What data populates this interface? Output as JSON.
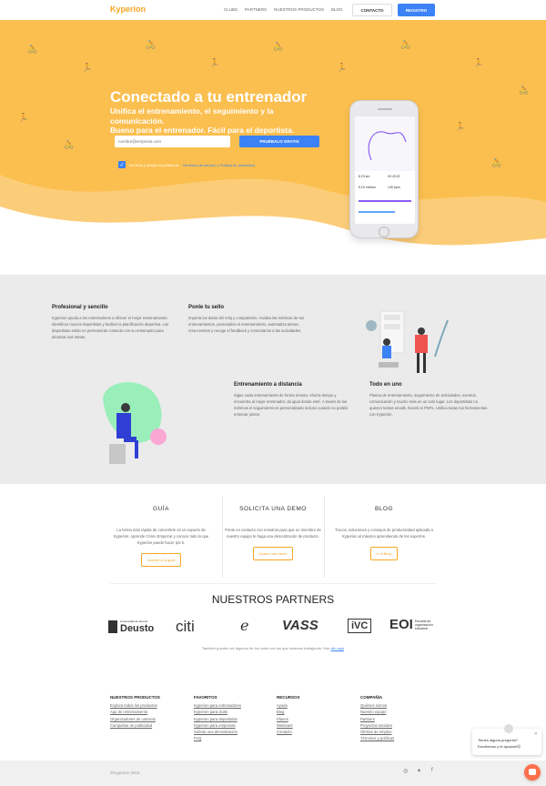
{
  "nav": {
    "logo": "Kyperion",
    "links": [
      "CLUBS",
      "PARTNERS",
      "NUESTROS PRODUCTOS",
      "BLOG"
    ],
    "contact": "CONTACTO",
    "register": "REGISTRO"
  },
  "hero": {
    "title": "Conectado a tu entrenador",
    "subtitle_1": "Unifica el entrenamiento, el seguimiento y la comunicación.",
    "subtitle_2": "Bueno para el entrenador. Fácil para el deportista.",
    "email_placeholder": "nombre@empresa.com",
    "try_button": "PRUÉBALO GRATIS",
    "terms_prefix": "He leído y acepto la política de",
    "terms_link": "Términos de servicio y Política de privacidad",
    "accent": "#3b82f6",
    "bg": "#fbbf4f"
  },
  "phone": {
    "stats": [
      "8.23 km",
      "00:43:22",
      "5:15 min/km",
      "145 bpm"
    ]
  },
  "features": [
    {
      "title": "Profesional y sencillo",
      "text": "Kyperion ayuda a los entrenadores a ofrecer el mejor entrenamiento. Identificar nuevos deportistas y facilitar la planificación deportiva. Los deportistas están en permanente contacto con su entrenador para alcanzar sus metas."
    },
    {
      "title": "Ponle tu sello",
      "text": "Importa los datos del reloj y compártelos. Analiza las métricas de tus entrenamientos, personaliza el entrenamiento, automatiza tareas, crea eventos y recoge el feedback y comentarios a las actividades."
    },
    {
      "title": "Entrenamiento a distancia",
      "text": "Sigue cada entrenamiento de forma remota. Ahorra tiempo y encuentra al mejor entrenador, da igual donde esté. A través de las métricas el seguimiento es personalizado incluso cuando no podéis entrenar juntos."
    },
    {
      "title": "Todo en uno",
      "text": "Planea de entrenamiento, seguimiento de actividades, eventos, comunicación y mucho más en un solo lugar. Los deportistas no quieren tantas emails. Excels ni PDFs. Unifica todas tus herramientas con Kyperion."
    }
  ],
  "cards": [
    {
      "title": "GUÍA",
      "text": "La forma más rápida de convertirte en un experto de Kyperion. Aprende Cómo Empezar y conoce todo lo que Kyperion puede hacer por ti.",
      "button": "Accede a la guía"
    },
    {
      "title": "SOLICITA UNA DEMO",
      "text": "Ponte en contacto con nosotros para que un miembro de nuestro equipo te haga una demostración de producto.",
      "button": "Quiero una demo"
    },
    {
      "title": "BLOG",
      "text": "Trucos, soluciones y consejos de productividad aplicada a Kyperion al máximo aprendiendo de los expertos.",
      "button": "Ir al Blog"
    }
  ],
  "partners": {
    "title": "NUESTROS PARTNERS",
    "deusto_small": "Universidad de Deusto",
    "deusto": "Deusto",
    "citi": "citi",
    "e": "e",
    "vass": "VASS",
    "ivc": "iVC",
    "eoi": "EOI",
    "eoi_sub": "Escuela de organización industrial",
    "note_prefix": "También puedes ver algunos de los clubs con los que estamos trabajando. Haz",
    "note_link": "clic aquí"
  },
  "footer": {
    "cols": [
      {
        "title": "NUESTROS PRODUCTOS",
        "items": [
          "Explora todos los productos",
          "App de entrenamiento",
          "Organizadores de carreras",
          "Campañas de publicidad"
        ]
      },
      {
        "title": "FAVORITOS",
        "items": [
          "Kyperion para entrenadores",
          "Kyperion para clubs",
          "Kyperion para deportistas",
          "Kyperion para empresas",
          "Solicita una demostración",
          "FAQ"
        ]
      },
      {
        "title": "RECURSOS",
        "items": [
          "Ayuda",
          "Blog",
          "Planes",
          "Webinars",
          "Contacto"
        ]
      },
      {
        "title": "COMPAÑÍA",
        "items": [
          "Quiénes somos",
          "Nuestro equipo",
          "Partners",
          "Proyectos sociales",
          "Ofertas de empleo",
          "Términos y políticas"
        ]
      }
    ],
    "copyright": "©Kyperion 2019"
  },
  "chat": {
    "question": "Tienes alguna pregunta?",
    "prompt": "Escríbenos y te ayudaré😉"
  }
}
